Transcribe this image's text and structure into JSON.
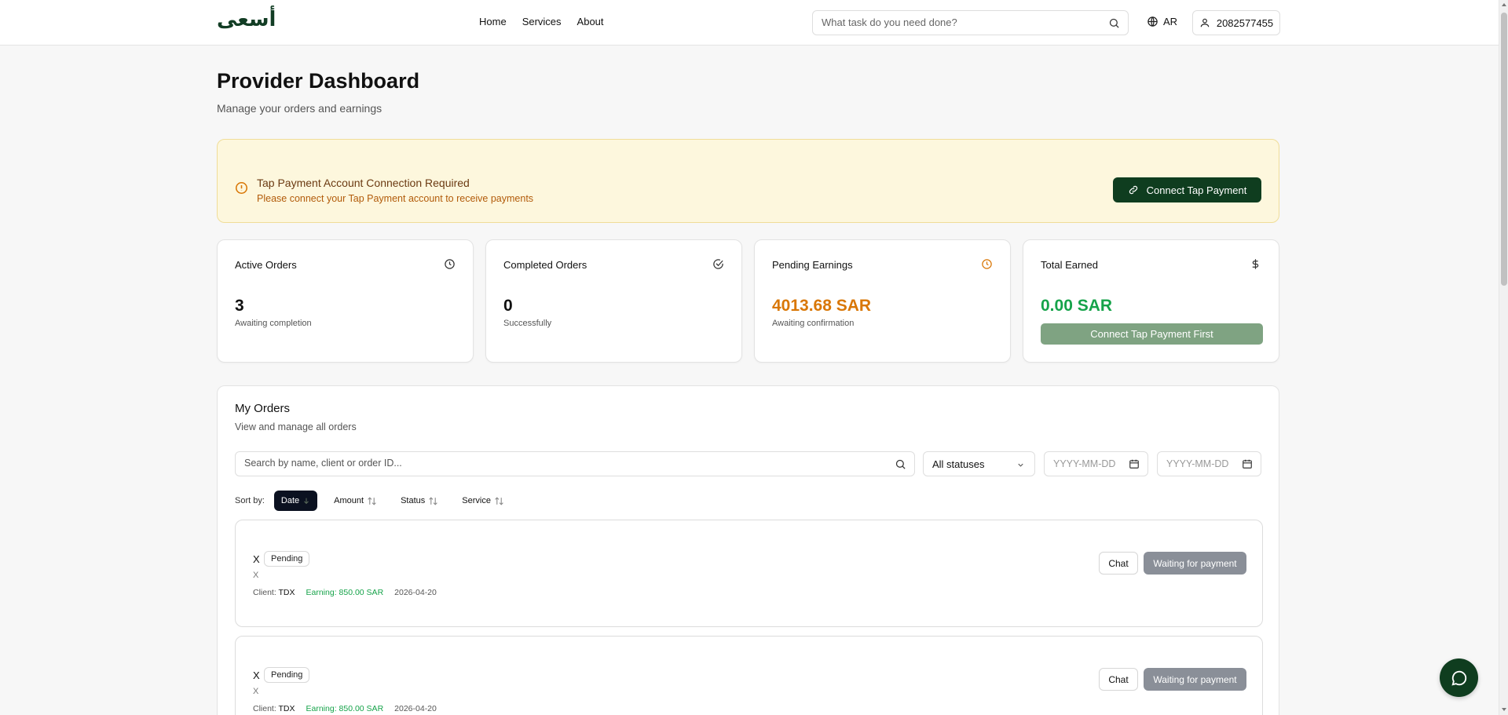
{
  "header": {
    "logo": "أسعى",
    "nav": [
      "Home",
      "Services",
      "About"
    ],
    "search_placeholder": "What task do you need done?",
    "language": "AR",
    "user_id": "2082577455"
  },
  "page": {
    "title": "Provider Dashboard",
    "subtitle": "Manage your orders and earnings"
  },
  "banner": {
    "title": "Tap Payment Account Connection Required",
    "text": "Please connect your Tap Payment account to receive payments",
    "button": "Connect Tap Payment"
  },
  "stats": {
    "active": {
      "label": "Active Orders",
      "value": "3",
      "hint": "Awaiting completion",
      "icon": "clock-icon"
    },
    "completed": {
      "label": "Completed Orders",
      "value": "0",
      "hint": "Successfully",
      "icon": "check-circle-icon"
    },
    "pending": {
      "label": "Pending Earnings",
      "value": "4013.68 SAR",
      "hint": "Awaiting confirmation",
      "icon": "clock-icon",
      "color": "#d97706"
    },
    "total": {
      "label": "Total Earned",
      "value": "0.00 SAR",
      "button": "Connect Tap Payment First",
      "icon": "dollar-icon",
      "color": "#16a34a"
    }
  },
  "orders": {
    "title": "My Orders",
    "subtitle": "View and manage all orders",
    "search_placeholder": "Search by name, client or order ID...",
    "status_filter": "All statuses",
    "date_from_placeholder": "YYYY-MM-DD",
    "date_to_placeholder": "YYYY-MM-DD",
    "sort_label": "Sort by:",
    "sort_options": [
      "Date",
      "Amount",
      "Status",
      "Service"
    ],
    "sort_active": "Date",
    "items": [
      {
        "title": "X",
        "status": "Pending",
        "description": "X",
        "client_label": "Client:",
        "client": "TDX",
        "earning": "Earning: 850.00 SAR",
        "date": "2026-04-20",
        "chat": "Chat",
        "action": "Waiting for payment"
      },
      {
        "title": "X",
        "status": "Pending",
        "description": "X",
        "client_label": "Client:",
        "client": "TDX",
        "earning": "Earning: 850.00 SAR",
        "date": "2026-04-20",
        "chat": "Chat",
        "action": "Waiting for payment"
      }
    ]
  },
  "colors": {
    "brand": "#0f3d1f",
    "banner_bg": "#fdf7dd",
    "warning": "#d97706",
    "success": "#16a34a"
  }
}
